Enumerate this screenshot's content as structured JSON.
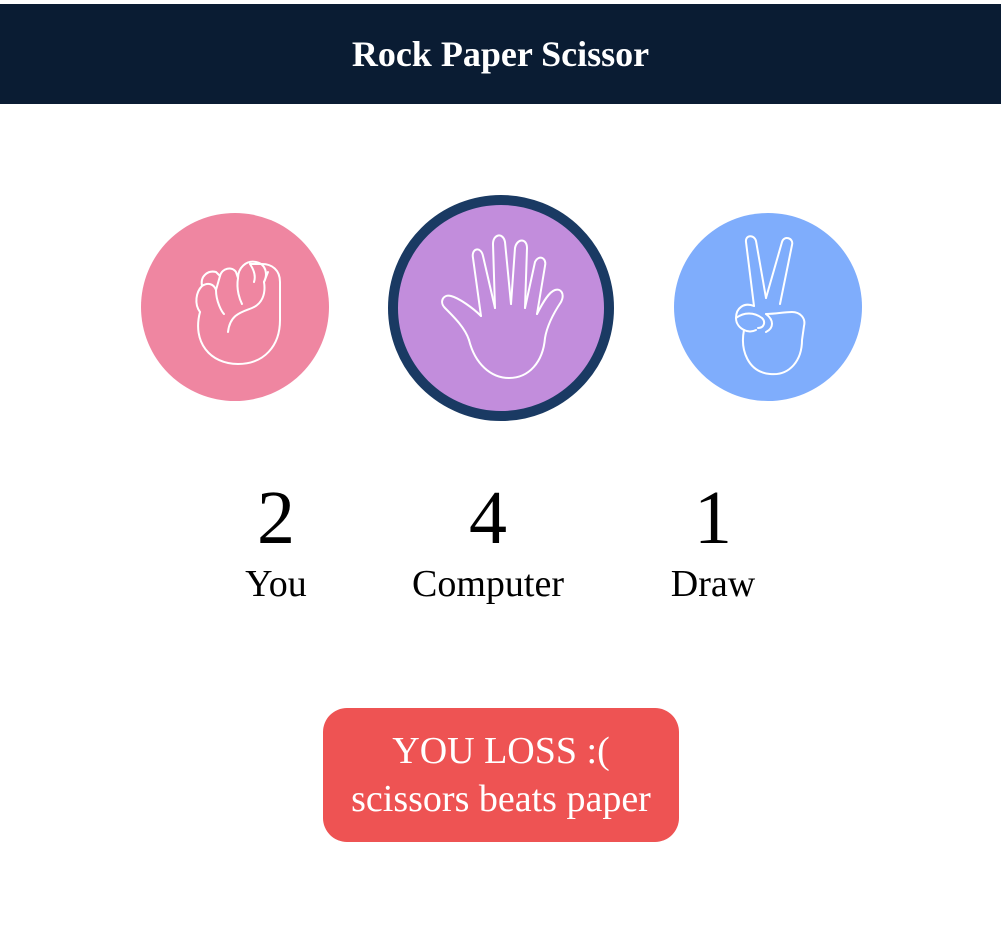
{
  "header": {
    "title": "Rock Paper Scissor"
  },
  "choices": [
    {
      "id": "rock",
      "icon": "fist-icon",
      "color": "#ef86a1",
      "selected": false
    },
    {
      "id": "paper",
      "icon": "open-hand-icon",
      "color": "#c28ddc",
      "selected": true,
      "ring_color": "#1a3a63"
    },
    {
      "id": "scissors",
      "icon": "peace-sign-icon",
      "color": "#7fadfc",
      "selected": false
    }
  ],
  "scores": {
    "user": {
      "value": "2",
      "label": "You"
    },
    "computer": {
      "value": "4",
      "label": "Computer"
    },
    "draw": {
      "value": "1",
      "label": "Draw"
    }
  },
  "result": {
    "headline": "YOU LOSS :(",
    "detail": "scissors beats paper",
    "color": "#ee5353"
  },
  "colors": {
    "header_bg": "#0a1c33",
    "page_bg": "#ffffff"
  }
}
